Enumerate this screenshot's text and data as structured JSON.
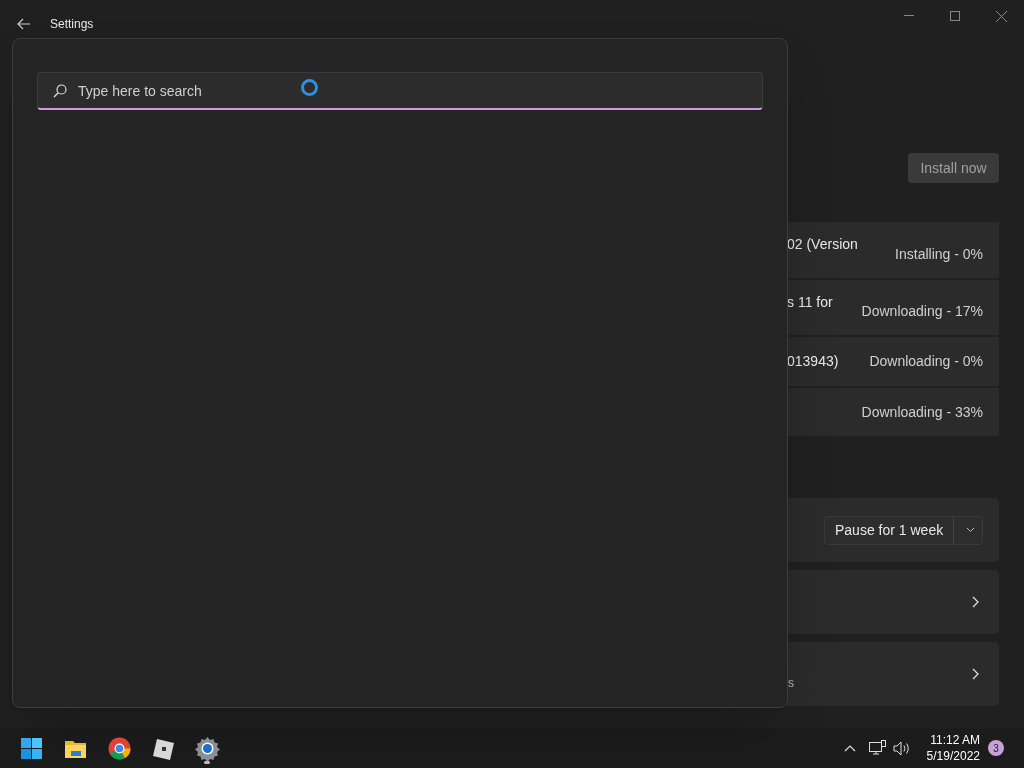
{
  "window": {
    "title": "Settings"
  },
  "search": {
    "placeholder": "Type here to search"
  },
  "install_button": "Install now",
  "updates": [
    {
      "name": "02 (Version",
      "status": "Installing - 0%"
    },
    {
      "name": "s 11 for",
      "status": "Downloading - 17%"
    },
    {
      "name": "013943)",
      "status": "Downloading - 0%"
    },
    {
      "status": "Downloading - 33%"
    }
  ],
  "pause": {
    "label": "Pause for 1 week"
  },
  "link_rows": [
    {
      "kind": "chevron"
    },
    {
      "kind": "chevron",
      "text": "s"
    }
  ],
  "taskbar": {
    "apps": [
      {
        "kind": "start",
        "running": false
      },
      {
        "kind": "folder",
        "running": false
      },
      {
        "kind": "chrome",
        "running": false
      },
      {
        "kind": "cube",
        "running": false
      },
      {
        "kind": "settings",
        "running": true
      }
    ],
    "time": "11:12 AM",
    "date": "5/19/2022",
    "notification_count": "3"
  }
}
